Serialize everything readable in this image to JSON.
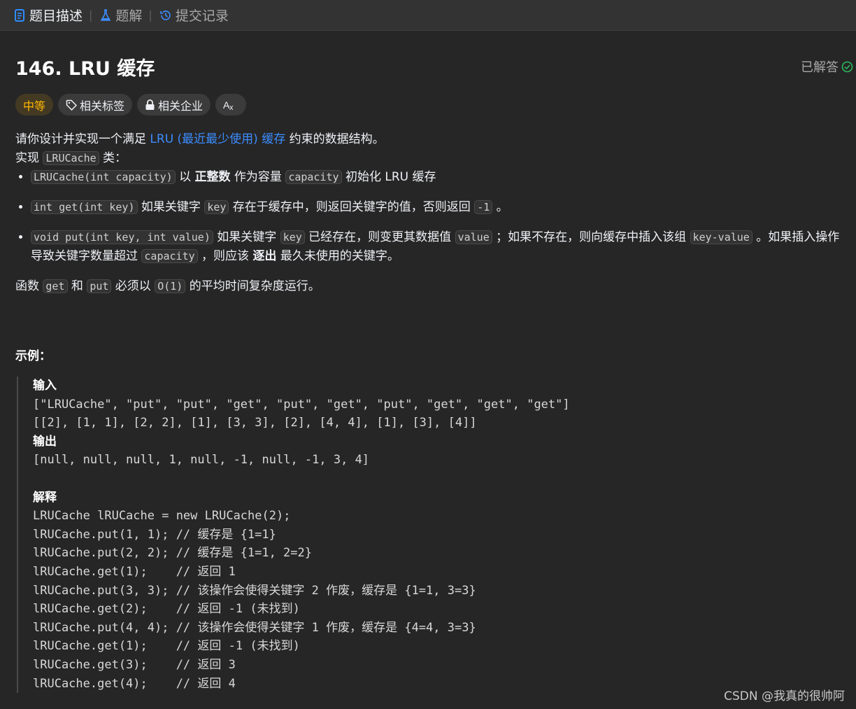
{
  "tabs": [
    {
      "label": "题目描述",
      "icon": "document-icon",
      "active": true
    },
    {
      "label": "题解",
      "icon": "flask-icon",
      "active": false
    },
    {
      "label": "提交记录",
      "icon": "history-icon",
      "active": false
    }
  ],
  "problem": {
    "title": "146. LRU 缓存",
    "status": "已解答",
    "status_icon": "check-circle-icon",
    "accent_color": "#2cbb5d"
  },
  "tags": {
    "difficulty": "中等",
    "difficulty_color": "#ffb800",
    "topics": "相关标签",
    "companies": "相关企业",
    "translate_icon": "translate-icon"
  },
  "desc": {
    "l1_pre": "请你设计并实现一个满足 ",
    "l1_link": "LRU (最近最少使用) 缓存",
    "l1_post": " 约束的数据结构。",
    "l2_pre": "实现 ",
    "l2_code": "LRUCache",
    "l2_post": " 类：",
    "b1_code": "LRUCache(int capacity)",
    "b1_a": " 以 ",
    "b1_bold": "正整数",
    "b1_b": " 作为容量 ",
    "b1_code2": "capacity",
    "b1_c": " 初始化 LRU 缓存",
    "b2_code": "int get(int key)",
    "b2_a": " 如果关键字 ",
    "b2_code2": "key",
    "b2_b": " 存在于缓存中，则返回关键字的值，否则返回 ",
    "b2_code3": "-1",
    "b2_c": " 。",
    "b3_code": "void put(int key, int value)",
    "b3_a": " 如果关键字 ",
    "b3_code2": "key",
    "b3_b": " 已经存在，则变更其数据值 ",
    "b3_code3": "value",
    "b3_c": " ；如果不存在，则向缓存中插入该组 ",
    "b3_code4": "key-value",
    "b3_d": " 。如果插入操作导致关键字数量超过 ",
    "b3_code5": "capacity",
    "b3_e": " ，则应该 ",
    "b3_bold": "逐出",
    "b3_f": " 最久未使用的关键字。",
    "f_pre": "函数 ",
    "f_code1": "get",
    "f_mid1": " 和 ",
    "f_code2": "put",
    "f_mid2": " 必须以 ",
    "f_code3": "O(1)",
    "f_post": " 的平均时间复杂度运行。"
  },
  "example": {
    "title": "示例：",
    "input_label": "输入",
    "input_line1": "[\"LRUCache\", \"put\", \"put\", \"get\", \"put\", \"get\", \"put\", \"get\", \"get\", \"get\"]",
    "input_line2": "[[2], [1, 1], [2, 2], [1], [3, 3], [2], [4, 4], [1], [3], [4]]",
    "output_label": "输出",
    "output_line": "[null, null, null, 1, null, -1, null, -1, 3, 4]",
    "explain_label": "解释",
    "explain_lines": [
      "LRUCache lRUCache = new LRUCache(2);",
      "lRUCache.put(1, 1); // 缓存是 {1=1}",
      "lRUCache.put(2, 2); // 缓存是 {1=1, 2=2}",
      "lRUCache.get(1);    // 返回 1",
      "lRUCache.put(3, 3); // 该操作会使得关键字 2 作废，缓存是 {1=1, 3=3}",
      "lRUCache.get(2);    // 返回 -1 (未找到)",
      "lRUCache.put(4, 4); // 该操作会使得关键字 1 作废，缓存是 {4=4, 3=3}",
      "lRUCache.get(1);    // 返回 -1 (未找到)",
      "lRUCache.get(3);    // 返回 3",
      "lRUCache.get(4);    // 返回 4"
    ]
  },
  "watermark": "CSDN @我真的很帅阿"
}
